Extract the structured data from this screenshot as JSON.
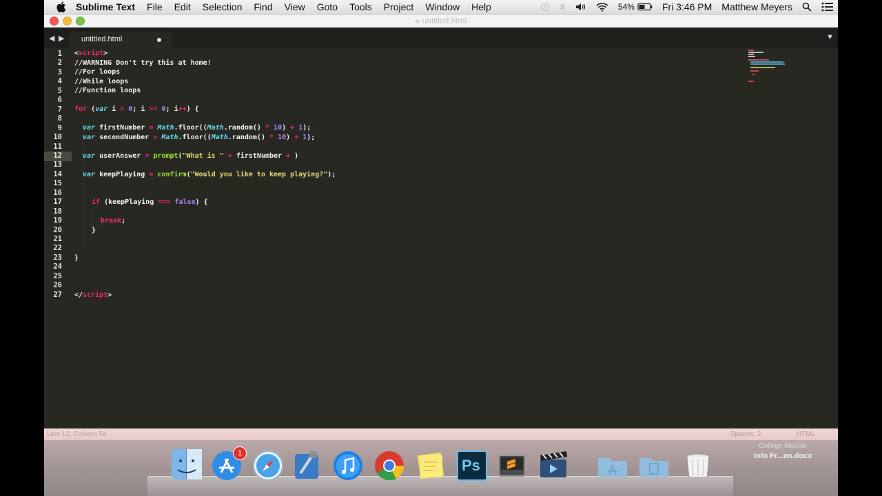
{
  "menubar": {
    "app_name": "Sublime Text",
    "menus": [
      "File",
      "Edit",
      "Selection",
      "Find",
      "View",
      "Goto",
      "Tools",
      "Project",
      "Window",
      "Help"
    ],
    "battery": "54%",
    "clock": "Fri 3:46 PM",
    "user": "Matthew Meyers"
  },
  "window": {
    "title": "untitled.html"
  },
  "tab": {
    "name": "untitled.html"
  },
  "editor": {
    "current_line": 12,
    "line_numbers": [
      "1",
      "2",
      "3",
      "4",
      "5",
      "6",
      "7",
      "8",
      "9",
      "10",
      "11",
      "12",
      "13",
      "14",
      "15",
      "16",
      "17",
      "18",
      "19",
      "20",
      "21",
      "22",
      "23",
      "24",
      "25",
      "26",
      "27"
    ]
  },
  "code": {
    "l1_open": "<",
    "l1_tag": "script",
    "l1_close": ">",
    "l2": "//WARNING Don't try this at home!",
    "l3": "//For loops",
    "l4": "//While loops",
    "l5": "//Function loops",
    "l7_for": "for",
    "l7_a": " (",
    "l7_var": "var",
    "l7_b": " i ",
    "l7_eq": "=",
    "l7_c": " ",
    "l7_zero": "0",
    "l7_d": "; i ",
    "l7_ge": ">=",
    "l7_e": " ",
    "l7_zero2": "0",
    "l7_f": "; i",
    "l7_inc": "++",
    "l7_g": ") {",
    "l9_var": "var",
    "l9_a": " firstNumber ",
    "l9_eq": "=",
    "l9_b": " ",
    "l9_math": "Math",
    "l9_c": ".floor((",
    "l9_math2": "Math",
    "l9_d": ".random() ",
    "l9_mul": "*",
    "l9_e": " ",
    "l9_ten": "10",
    "l9_f": ") ",
    "l9_plus": "+",
    "l9_g": " ",
    "l9_one": "1",
    "l9_h": ");",
    "l10_var": "var",
    "l10_a": " secondNumber ",
    "l10_eq": "=",
    "l10_b": " ",
    "l10_math": "Math",
    "l10_c": ".floor((",
    "l10_math2": "Math",
    "l10_d": ".random() ",
    "l10_mul": "*",
    "l10_e": " ",
    "l10_ten": "10",
    "l10_f": ") ",
    "l10_plus": "+",
    "l10_g": " ",
    "l10_one": "1",
    "l10_h": ");",
    "l12_var": "var",
    "l12_a": " userAnswer ",
    "l12_eq": "=",
    "l12_b": " ",
    "l12_fn": "prompt",
    "l12_c": "(",
    "l12_str": "\"What is \"",
    "l12_d": " ",
    "l12_plus": "+",
    "l12_e": " firstNumber ",
    "l12_plus2": "+",
    "l12_f": " )",
    "l14_var": "var",
    "l14_a": " keepPlaying ",
    "l14_eq": "=",
    "l14_b": " ",
    "l14_fn": "confirm",
    "l14_c": "(",
    "l14_str": "\"Would you like to keep playing?\"",
    "l14_d": ");",
    "l17_if": "if",
    "l17_a": " (keepPlaying ",
    "l17_eq": "===",
    "l17_b": " ",
    "l17_false": "false",
    "l17_c": ") {",
    "l19_break": "break",
    "l19_a": ";",
    "l20": "}",
    "l23": "}",
    "l27_open": "</",
    "l27_tag": "script",
    "l27_close": ">"
  },
  "statusbar": {
    "position": "Line 12, Column 54",
    "spaces": "Spaces: 2",
    "syntax": "HTML"
  },
  "dock": {
    "items": [
      "finder-icon",
      "app-store-icon",
      "safari-icon",
      "xcode-icon",
      "itunes-icon",
      "chrome-icon",
      "stickies-icon",
      "photoshop-icon",
      "sublime-text-icon",
      "video-icon",
      "applications-folder-icon",
      "documents-folder-icon",
      "trash-icon"
    ],
    "app_store_badge": "1",
    "photoshop_label": "Ps"
  },
  "desktop": {
    "file_line1": "College Module",
    "file_line2": "Info Fr...en.docx"
  },
  "colors": {
    "editor_bg": "#272822",
    "keyword": "#f92672",
    "string": "#e6db74",
    "number": "#ae81ff",
    "builtin": "#66d9ef"
  }
}
